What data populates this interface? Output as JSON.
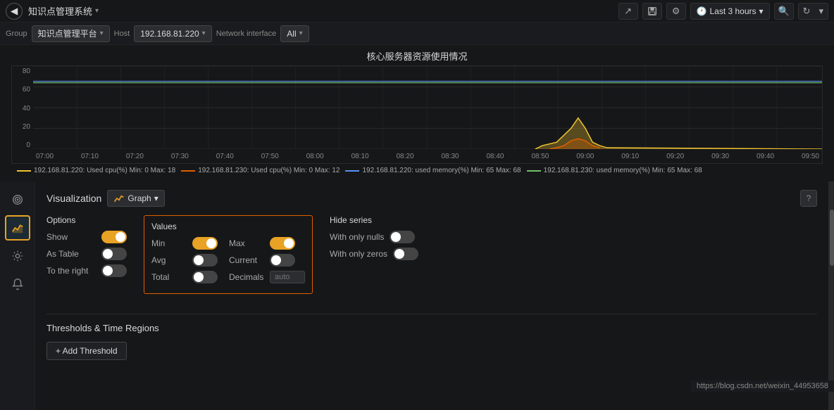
{
  "nav": {
    "title": "知识点管理系统",
    "back_label": "◀",
    "caret": "▾",
    "icons": {
      "share": "↗",
      "save": "💾",
      "settings": "⚙"
    },
    "time_picker": {
      "label": "Last 3 hours",
      "icon": "🕐"
    },
    "search_icon": "🔍",
    "refresh_icon": "↻",
    "refresh_caret": "▾"
  },
  "toolbar": {
    "group_label": "Group",
    "host_label": "Host",
    "network_label": "Network interface",
    "group_value": "知识点管理平台",
    "host_value": "192.168.81.220",
    "network_value": "All"
  },
  "chart": {
    "title": "核心服务器资源使用情况",
    "y_axis": [
      "80",
      "60",
      "40",
      "20",
      "0"
    ],
    "x_labels": [
      "07:00",
      "07:10",
      "07:20",
      "07:30",
      "07:40",
      "07:50",
      "08:00",
      "08:10",
      "08:20",
      "08:30",
      "08:40",
      "08:50",
      "09:00",
      "09:10",
      "09:20",
      "09:30",
      "09:40",
      "09:50"
    ],
    "legend": [
      {
        "color": "#f0c230",
        "label": "192.168.81.220: Used cpu(%)  Min: 0  Max: 18"
      },
      {
        "color": "#e05f00",
        "label": "192.168.81.230: Used cpu(%)  Min: 0  Max: 12"
      },
      {
        "color": "#5794f2",
        "label": "192.168.81.220: used memory(%)  Min: 65  Max: 68"
      },
      {
        "color": "#73bf69",
        "label": "192.168.81.230: used memory(%)  Min: 65  Max: 68"
      }
    ]
  },
  "sidebar": {
    "icons": [
      {
        "name": "layers-icon",
        "symbol": "☰",
        "active": false
      },
      {
        "name": "chart-icon",
        "symbol": "📈",
        "active": true
      },
      {
        "name": "gear-icon",
        "symbol": "⚙",
        "active": false
      },
      {
        "name": "bell-icon",
        "symbol": "🔔",
        "active": false
      }
    ]
  },
  "visualization": {
    "title": "Visualization",
    "graph_label": "Graph",
    "help_label": "?",
    "options": {
      "title": "Options",
      "show_label": "Show",
      "as_table_label": "As Table",
      "to_right_label": "To the right"
    },
    "values": {
      "title": "Values",
      "min_label": "Min",
      "max_label": "Max",
      "avg_label": "Avg",
      "current_label": "Current",
      "total_label": "Total",
      "decimals_label": "Decimals",
      "decimals_placeholder": "auto"
    },
    "hide_series": {
      "title": "Hide series",
      "nulls_label": "With only nulls",
      "zeros_label": "With only zeros"
    }
  },
  "thresholds": {
    "title": "Thresholds & Time Regions",
    "add_label": "+ Add Threshold"
  },
  "url_bar": "https://blog.csdn.net/weixin_44953658"
}
